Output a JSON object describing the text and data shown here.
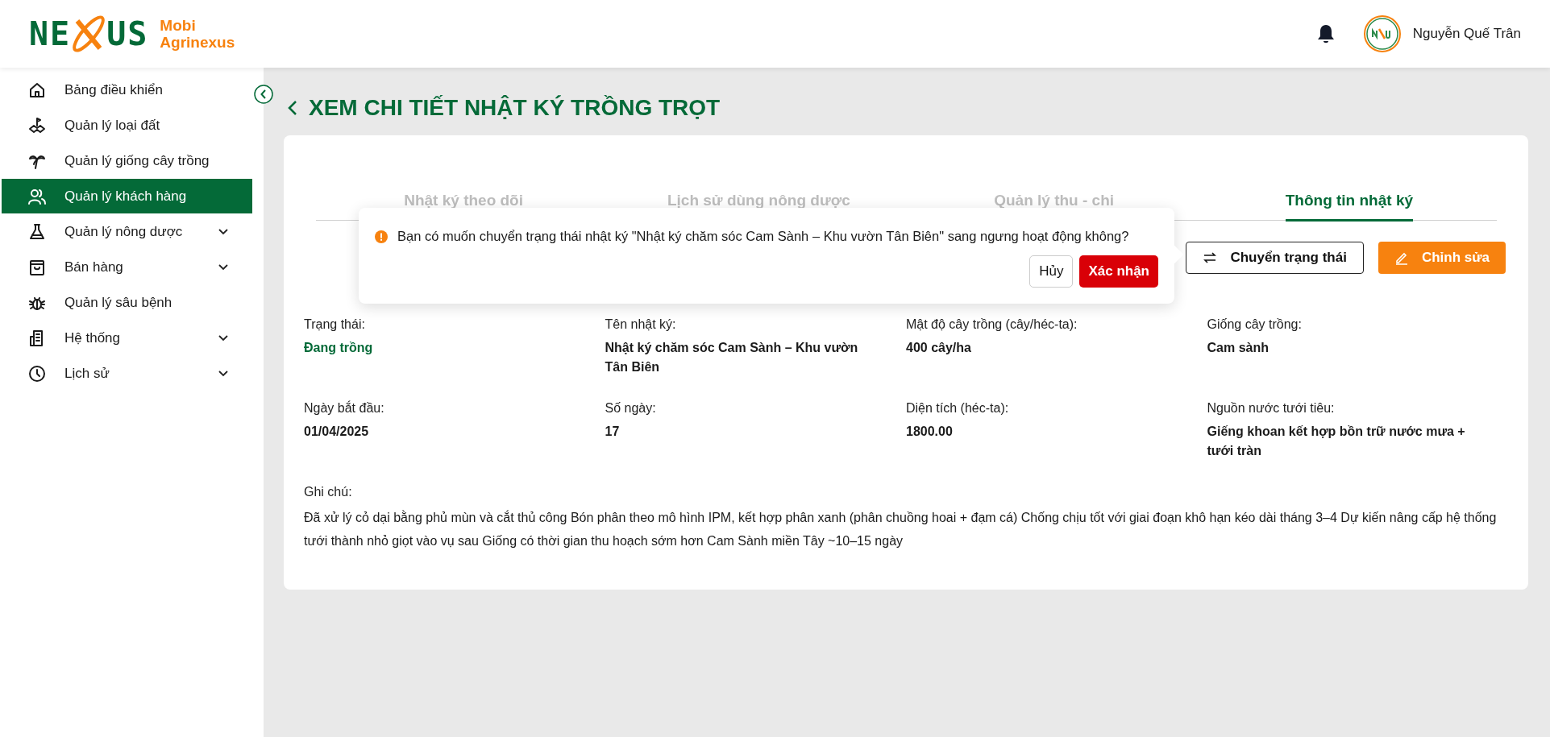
{
  "brand": {
    "mark_left": "NE",
    "mark_right": "US",
    "name_lines": [
      "Mobi",
      "Agrinexus"
    ]
  },
  "header": {
    "user_name": "Nguyễn Quế Trân"
  },
  "sidebar": {
    "items": [
      {
        "label": "Bảng điều khiển",
        "selected": false,
        "expandable": false
      },
      {
        "label": "Quản lý loại đất",
        "selected": false,
        "expandable": false
      },
      {
        "label": "Quản lý giống cây trồng",
        "selected": false,
        "expandable": false
      },
      {
        "label": "Quản lý khách hàng",
        "selected": true,
        "expandable": false
      },
      {
        "label": "Quản lý nông dược",
        "selected": false,
        "expandable": true
      },
      {
        "label": "Bán hàng",
        "selected": false,
        "expandable": true
      },
      {
        "label": "Quản lý sâu bệnh",
        "selected": false,
        "expandable": false
      },
      {
        "label": "Hệ thống",
        "selected": false,
        "expandable": true
      },
      {
        "label": "Lịch sử",
        "selected": false,
        "expandable": true
      }
    ]
  },
  "page": {
    "title": "XEM CHI TIẾT NHẬT KÝ TRỒNG TRỌT"
  },
  "tabs": [
    {
      "label": "Nhật ký theo dõi",
      "selected": false
    },
    {
      "label": "Lịch sử dùng nông dược",
      "selected": false
    },
    {
      "label": "Quản lý thu - chi",
      "selected": false
    },
    {
      "label": "Thông tin nhật ký",
      "selected": true
    }
  ],
  "actions": [
    {
      "label": "Chuyển trạng thái",
      "kind": "outline"
    },
    {
      "label": "Chỉnh sửa",
      "kind": "primary"
    }
  ],
  "confirm_popover": {
    "message": "Bạn có muốn chuyển trạng thái nhật ký \"Nhật ký chăm sóc Cam Sành – Khu vườn Tân Biên\" sang ngưng hoạt động không?",
    "buttons": [
      {
        "label": "Hủy",
        "kind": "default"
      },
      {
        "label": "Xác nhận",
        "kind": "danger"
      }
    ]
  },
  "fields": [
    {
      "label": "Trạng thái:",
      "value": "Đang trồng",
      "kind": "status"
    },
    {
      "label": "Tên nhật ký:",
      "value": "Nhật ký chăm sóc Cam Sành – Khu vườn Tân Biên",
      "kind": "plain"
    },
    {
      "label": "Mật độ cây trồng (cây/héc-ta):",
      "value": "400 cây/ha",
      "kind": "plain"
    },
    {
      "label": "Giống cây trồng:",
      "value": "Cam sành",
      "kind": "plain"
    },
    {
      "label": "Ngày bắt đầu:",
      "value": "01/04/2025",
      "kind": "plain"
    },
    {
      "label": "Số ngày:",
      "value": "17",
      "kind": "plain"
    },
    {
      "label": "Diện tích (héc-ta):",
      "value": "1800.00",
      "kind": "plain"
    },
    {
      "label": "Nguồn nước tưới tiêu:",
      "value": "Giếng khoan kết hợp bồn trữ nước mưa + tưới tràn",
      "kind": "plain"
    }
  ],
  "note": {
    "label": "Ghi chú:",
    "text": "Đã xử lý cỏ dại bằng phủ mùn và cắt thủ công Bón phân theo mô hình IPM, kết hợp phân xanh (phân chuồng hoai + đạm cá) Chống chịu tốt với giai đoạn khô hạn kéo dài tháng 3–4 Dự kiến nâng cấp hệ thống tưới thành nhỏ giọt vào vụ sau Giống có thời gian thu hoạch sớm hơn Cam Sành miền Tây ~10–15 ngày"
  }
}
